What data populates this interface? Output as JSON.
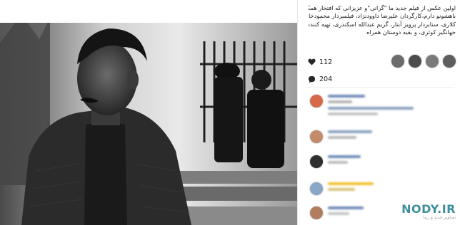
{
  "post": {
    "caption_lines": [
      "اولین عکس از فیلم جدید ما \"گرانی\"و عزیزانی که افتخار همکاری",
      "باهشونو دارم،کارگردان علیرضا داوودنژاد، فیلمبردار محمودخان",
      "کلاری، سنابردار پرویز آبنار، گریم عبدالله اسکندری، تهیه کننده",
      "جهانگیر کوثری، و بقیه دوستان همراه"
    ],
    "likes": "112",
    "comments": "204",
    "photo_alt": "Black and white photo of a man in a tweed jacket sitting on a bench"
  },
  "watermark": {
    "text": "NODY.IR",
    "subtext": "تصاویر جدید و زیبا"
  },
  "colors": {
    "accent": "#3d8f9e",
    "emoji": "#f2c12e"
  },
  "icons": {
    "like": "heart-icon",
    "comment": "comment-icon"
  }
}
